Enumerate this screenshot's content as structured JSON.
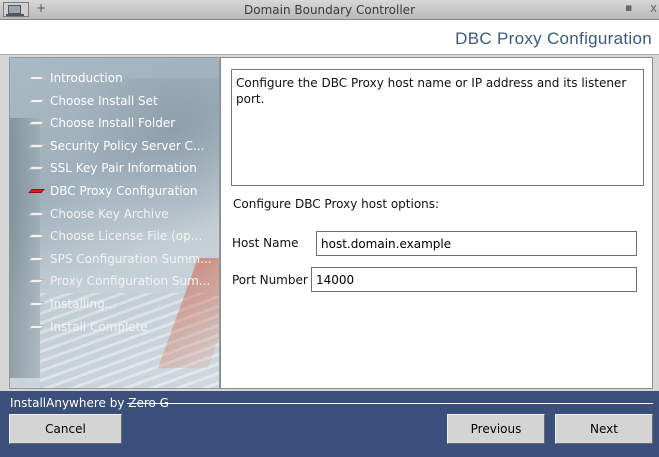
{
  "window": {
    "title": "Domain Boundary Controller",
    "pin_glyph": "+",
    "minimize_glyph": "▪",
    "close_glyph": "x"
  },
  "header": {
    "title": "DBC Proxy Configuration"
  },
  "sidebar": {
    "steps": [
      {
        "label": "Introduction",
        "state": "done"
      },
      {
        "label": "Choose Install Set",
        "state": "done"
      },
      {
        "label": "Choose Install Folder",
        "state": "done"
      },
      {
        "label": "Security Policy Server C...",
        "state": "done"
      },
      {
        "label": "SSL Key Pair Information",
        "state": "done"
      },
      {
        "label": "DBC Proxy Configuration",
        "state": "active"
      },
      {
        "label": "Choose Key Archive",
        "state": "pending"
      },
      {
        "label": "Choose License File (op...",
        "state": "pending"
      },
      {
        "label": "SPS Configuration Summ...",
        "state": "pending"
      },
      {
        "label": "Proxy Configuration Sum...",
        "state": "pending"
      },
      {
        "label": "Installing...",
        "state": "pending"
      },
      {
        "label": "Install Complete",
        "state": "pending"
      }
    ]
  },
  "content": {
    "description": "Configure the DBC Proxy host name or IP address and its listener port.",
    "options_label": "Configure DBC Proxy host options:",
    "host_name": {
      "label": "Host Name",
      "value": "host.domain.example"
    },
    "port_number": {
      "label": "Port Number",
      "value": "14000"
    }
  },
  "footer": {
    "brand": "InstallAnywhere by Zero G",
    "cancel_label": "Cancel",
    "previous_label": "Previous",
    "next_label": "Next"
  },
  "colors": {
    "header_title": "#3c5a7e",
    "footer_background": "#3a4f7a",
    "active_step_marker": "#c8261e"
  }
}
